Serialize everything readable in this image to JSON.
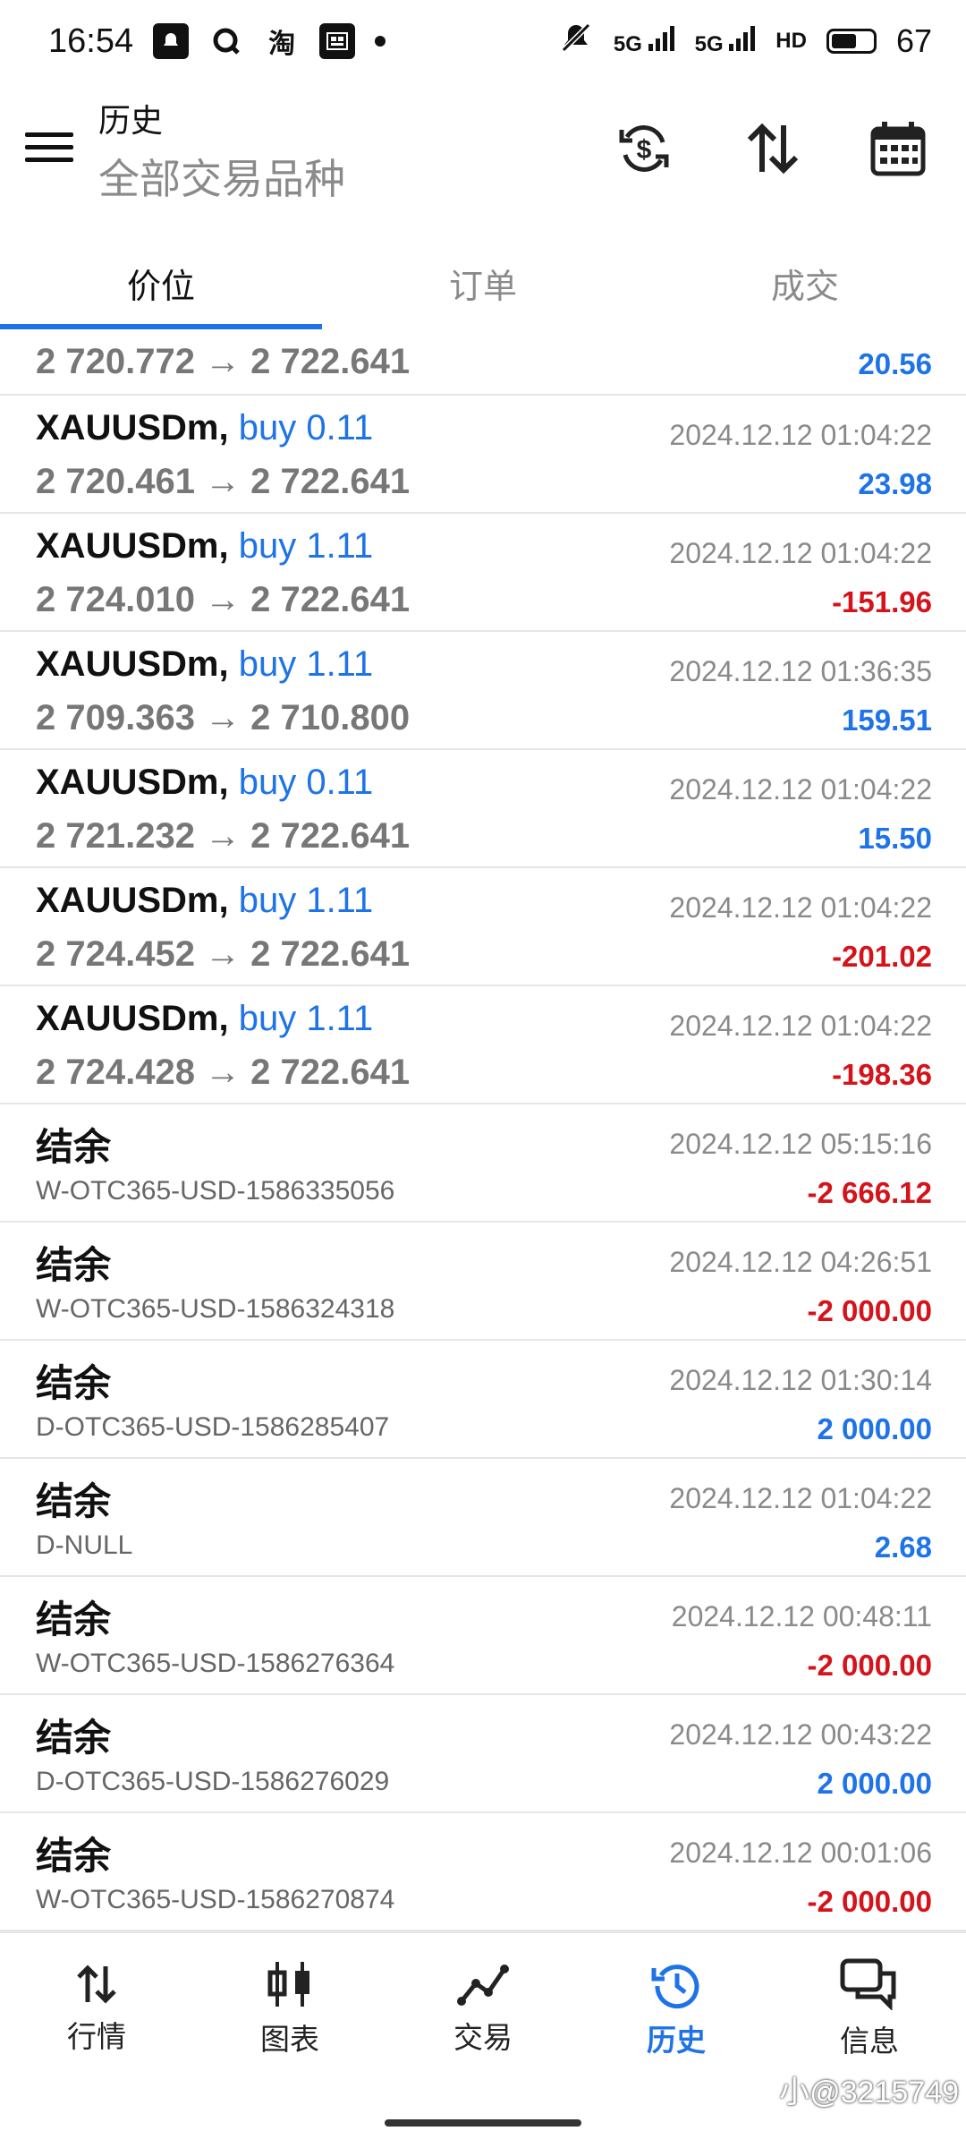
{
  "status_bar": {
    "time": "16:54",
    "apps": [
      "bell-app-icon",
      "q-app-icon",
      "taobao-app-icon",
      "gallery-app-icon"
    ],
    "app_glyph_taobao": "淘",
    "signal1": "5G",
    "signal2": "5G",
    "hd": "HD",
    "battery": "67",
    "battery_level": 0.67
  },
  "app_bar": {
    "title": "历史",
    "subtitle": "全部交易品种"
  },
  "tabs": [
    {
      "label": "价位",
      "active": true
    },
    {
      "label": "订单",
      "active": false
    },
    {
      "label": "成交",
      "active": false
    }
  ],
  "partial_row": {
    "prices": "2 720.772 → 2 722.641",
    "profit": "20.56",
    "positive": true
  },
  "deals": [
    {
      "symbol": "XAUUSDm,",
      "side": "buy 0.11",
      "prices": "2 720.461 → 2 722.641",
      "date": "2024.12.12 01:04:22",
      "profit": "23.98",
      "positive": true
    },
    {
      "symbol": "XAUUSDm,",
      "side": "buy 1.11",
      "prices": "2 724.010 → 2 722.641",
      "date": "2024.12.12 01:04:22",
      "profit": "-151.96",
      "positive": false
    },
    {
      "symbol": "XAUUSDm,",
      "side": "buy 1.11",
      "prices": "2 709.363 → 2 710.800",
      "date": "2024.12.12 01:36:35",
      "profit": "159.51",
      "positive": true
    },
    {
      "symbol": "XAUUSDm,",
      "side": "buy 0.11",
      "prices": "2 721.232 → 2 722.641",
      "date": "2024.12.12 01:04:22",
      "profit": "15.50",
      "positive": true
    },
    {
      "symbol": "XAUUSDm,",
      "side": "buy 1.11",
      "prices": "2 724.452 → 2 722.641",
      "date": "2024.12.12 01:04:22",
      "profit": "-201.02",
      "positive": false
    },
    {
      "symbol": "XAUUSDm,",
      "side": "buy 1.11",
      "prices": "2 724.428 → 2 722.641",
      "date": "2024.12.12 01:04:22",
      "profit": "-198.36",
      "positive": false
    }
  ],
  "balances": [
    {
      "label": "结余",
      "comment": "W-OTC365-USD-1586335056",
      "date": "2024.12.12 05:15:16",
      "amount": "-2 666.12",
      "positive": false
    },
    {
      "label": "结余",
      "comment": "W-OTC365-USD-1586324318",
      "date": "2024.12.12 04:26:51",
      "amount": "-2 000.00",
      "positive": false
    },
    {
      "label": "结余",
      "comment": "D-OTC365-USD-1586285407",
      "date": "2024.12.12 01:30:14",
      "amount": "2 000.00",
      "positive": true
    },
    {
      "label": "结余",
      "comment": "D-NULL",
      "date": "2024.12.12 01:04:22",
      "amount": "2.68",
      "positive": true
    },
    {
      "label": "结余",
      "comment": "W-OTC365-USD-1586276364",
      "date": "2024.12.12 00:48:11",
      "amount": "-2 000.00",
      "positive": false
    },
    {
      "label": "结余",
      "comment": "D-OTC365-USD-1586276029",
      "date": "2024.12.12 00:43:22",
      "amount": "2 000.00",
      "positive": true
    },
    {
      "label": "结余",
      "comment": "W-OTC365-USD-1586270874",
      "date": "2024.12.12 00:01:06",
      "amount": "-2 000.00",
      "positive": false
    }
  ],
  "bottom_nav": [
    {
      "label": "行情",
      "icon": "quotes-icon",
      "active": false
    },
    {
      "label": "图表",
      "icon": "chart-icon",
      "active": false
    },
    {
      "label": "交易",
      "icon": "trade-icon",
      "active": false
    },
    {
      "label": "历史",
      "icon": "history-icon",
      "active": true
    },
    {
      "label": "信息",
      "icon": "messages-icon",
      "active": false
    }
  ],
  "watermark": "小@3215749",
  "colors": {
    "accent": "#1e73e8",
    "negative": "#d4131b",
    "muted": "#8a8a8a"
  }
}
